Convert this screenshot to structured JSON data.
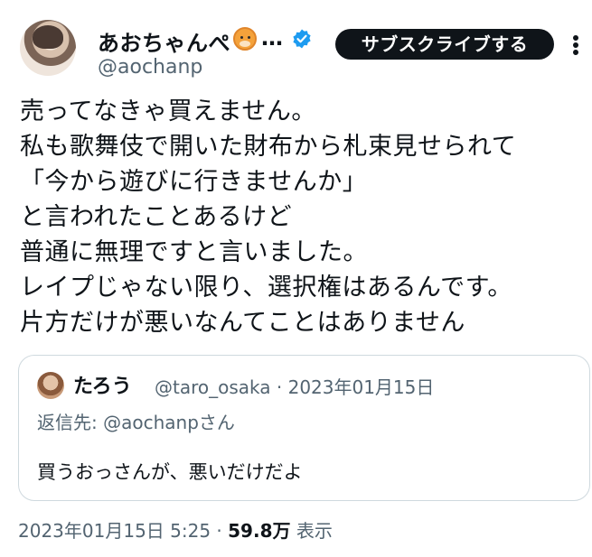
{
  "author": {
    "display_name": "あおちゃんぺ",
    "ellipsis": "…",
    "handle": "@aochanp"
  },
  "subscribe_label": "サブスクライブする",
  "body_lines": [
    "売ってなきゃ買えません。",
    "私も歌舞伎で開いた財布から札束見せられて",
    "「今から遊びに行きませんか」",
    "と言われたことあるけど",
    "普通に無理ですと言いました。",
    "レイプじゃない限り、選択権はあるんです。",
    "片方だけが悪いなんてことはありません"
  ],
  "quote": {
    "name": "たろう",
    "meta": "@taro_osaka · 2023年01月15日",
    "reply_to": "返信先: @aochanpさん",
    "text": "買うおっさんが、悪いだけだよ"
  },
  "footer": {
    "timestamp": "2023年01月15日 5:25 · ",
    "views_count": "59.8万",
    "views_label": " 表示"
  },
  "colors": {
    "text": "#0f1419",
    "secondary": "#536471",
    "verified": "#1d9bf0",
    "border": "#cfd9de"
  }
}
